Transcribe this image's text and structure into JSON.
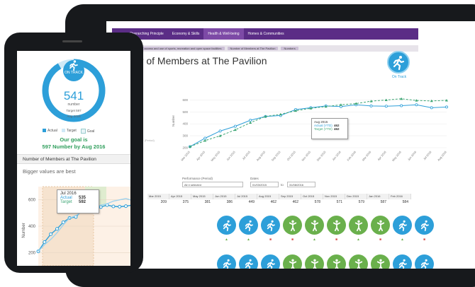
{
  "colors": {
    "accent": "#2d9fd9",
    "nav": "#5b2d86",
    "green": "#6ab04c",
    "target": "#3ea675",
    "goal": "#2e9e5b"
  },
  "tablet": {
    "nav_items": [
      "me",
      "Overarching Principle",
      "Economy & Skills",
      "Health & Well-being",
      "Homes & Communities"
    ],
    "nav_active_index": 3,
    "breadcrumbs": [
      "being",
      "Improve access and use of sports, recreation and open space facilities",
      "Number of Members at The Pavilion",
      "Numbers"
    ],
    "page_title": "er of Members at The Pavilion",
    "status_label": "On Track",
    "status_icon": "running-person-icon",
    "legend": [
      "l (YTD)",
      "(YTD)",
      "eriod",
      "(Period)",
      "(Period)",
      "ast Year (Period)"
    ],
    "tooltip": {
      "date": "Aug 2015",
      "actual_label": "Actual (YTD)",
      "actual_value": "462",
      "target_label": "Target (YTD)",
      "target_value": "462"
    },
    "y_axis_label": "Number",
    "filters": {
      "performance_label": "Performance (Period)",
      "performance_value": "All 4 selected",
      "dates_label": "Dates",
      "date_from": "01/03/2015",
      "to_label": "to",
      "date_to": "31/08/2016"
    },
    "grid_months": [
      "Mar 2015",
      "Apr 2015",
      "May 2015",
      "Jun 2015",
      "Jul 2015",
      "Aug 2015",
      "Sep 2015",
      "Oct 2015",
      "Nov 2015",
      "Dec 2015",
      "Jan 2016",
      "Feb 2016"
    ],
    "grid_values": [
      "209",
      "375",
      "381",
      "386",
      "449",
      "462",
      "462",
      "578",
      "571",
      "579",
      "587",
      "584"
    ],
    "row_icons": [
      "blue",
      "blue",
      "blue",
      "green",
      "green",
      "green",
      "green",
      "green",
      "blue",
      "blue"
    ],
    "row_flags": [
      "▲",
      "▲",
      "■",
      "■",
      "▲",
      "■",
      "▲",
      "■",
      "▲",
      "■"
    ]
  },
  "phone": {
    "gauge": {
      "status": "ON TRACK",
      "value": "541",
      "unit": "number",
      "target": "Target 597",
      "date": "Aug 2016"
    },
    "legend": [
      "Actual",
      "Target",
      "Goal"
    ],
    "goal_line1": "Our goal is",
    "goal_line2": "597 Number by Aug 2016",
    "section_title": "Number of Members at The Pavilion",
    "subtitle": "Bigger values are best",
    "y_label": "Number",
    "y_ticks": [
      "600",
      "400",
      "200"
    ],
    "tooltip": {
      "date": "Jul 2016",
      "actual_label": "Actual",
      "actual_value": "535",
      "target_label": "Target",
      "target_value": "592"
    }
  },
  "chart_data": [
    {
      "type": "line",
      "title": "",
      "ylabel": "Number",
      "x": [
        "Mar 2015",
        "Apr 2015",
        "May 2015",
        "Jun 2015",
        "Jul 2015",
        "Aug 2015",
        "Sep 2015",
        "Oct 2015",
        "Nov 2015",
        "Dec 2015",
        "Jan 2016",
        "Feb 2016",
        "Mar 2016",
        "Apr 2016",
        "May 2016",
        "Jun 2016",
        "Jul 2016",
        "Aug 2016"
      ],
      "ylim": [
        200,
        650
      ],
      "yticks": [
        200,
        300,
        400,
        500,
        600
      ],
      "series": [
        {
          "name": "Actual (YTD)",
          "values": [
            209,
            280,
            340,
            380,
            430,
            462,
            470,
            520,
            535,
            550,
            545,
            560,
            550,
            548,
            552,
            560,
            535,
            541
          ]
        },
        {
          "name": "Target (YTD)",
          "values": [
            209,
            260,
            300,
            350,
            410,
            462,
            480,
            510,
            530,
            545,
            560,
            570,
            590,
            600,
            610,
            596,
            592,
            597
          ]
        }
      ]
    }
  ]
}
